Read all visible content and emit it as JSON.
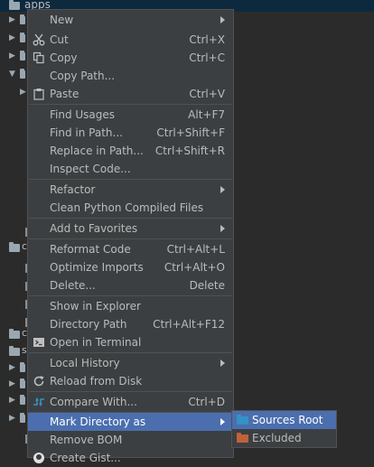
{
  "tree": {
    "top_label": "apps",
    "frag_1": "c",
    "frag_2": "c",
    "frag_3": "s"
  },
  "menu": {
    "items": [
      {
        "label": "New",
        "shortcut": "",
        "submenu": true
      },
      {
        "label": "Cut",
        "shortcut": "Ctrl+X"
      },
      {
        "label": "Copy",
        "shortcut": "Ctrl+C"
      },
      {
        "label": "Copy Path...",
        "shortcut": ""
      },
      {
        "label": "Paste",
        "shortcut": "Ctrl+V"
      },
      {
        "label": "Find Usages",
        "shortcut": "Alt+F7"
      },
      {
        "label": "Find in Path...",
        "shortcut": "Ctrl+Shift+F"
      },
      {
        "label": "Replace in Path...",
        "shortcut": "Ctrl+Shift+R"
      },
      {
        "label": "Inspect Code...",
        "shortcut": ""
      },
      {
        "label": "Refactor",
        "shortcut": "",
        "submenu": true
      },
      {
        "label": "Clean Python Compiled Files",
        "shortcut": ""
      },
      {
        "label": "Add to Favorites",
        "shortcut": "",
        "submenu": true
      },
      {
        "label": "Reformat Code",
        "shortcut": "Ctrl+Alt+L"
      },
      {
        "label": "Optimize Imports",
        "shortcut": "Ctrl+Alt+O"
      },
      {
        "label": "Delete...",
        "shortcut": "Delete"
      },
      {
        "label": "Show in Explorer",
        "shortcut": ""
      },
      {
        "label": "Directory Path",
        "shortcut": "Ctrl+Alt+F12"
      },
      {
        "label": "Open in Terminal",
        "shortcut": ""
      },
      {
        "label": "Local History",
        "shortcut": "",
        "submenu": true
      },
      {
        "label": "Reload from Disk",
        "shortcut": ""
      },
      {
        "label": "Compare With...",
        "shortcut": "Ctrl+D"
      },
      {
        "label": "Mark Directory as",
        "shortcut": "",
        "submenu": true,
        "selected": true
      },
      {
        "label": "Remove BOM",
        "shortcut": ""
      },
      {
        "label": "Create Gist...",
        "shortcut": ""
      }
    ]
  },
  "submenu": {
    "items": [
      {
        "label": "Sources Root",
        "color": "#3592c4",
        "selected": true
      },
      {
        "label": "Excluded",
        "color": "#c0623a"
      }
    ]
  },
  "colors": {
    "menu_bg": "#3c3f41",
    "selection": "#4b6eaf",
    "editor_bg": "#2b2b2b"
  }
}
